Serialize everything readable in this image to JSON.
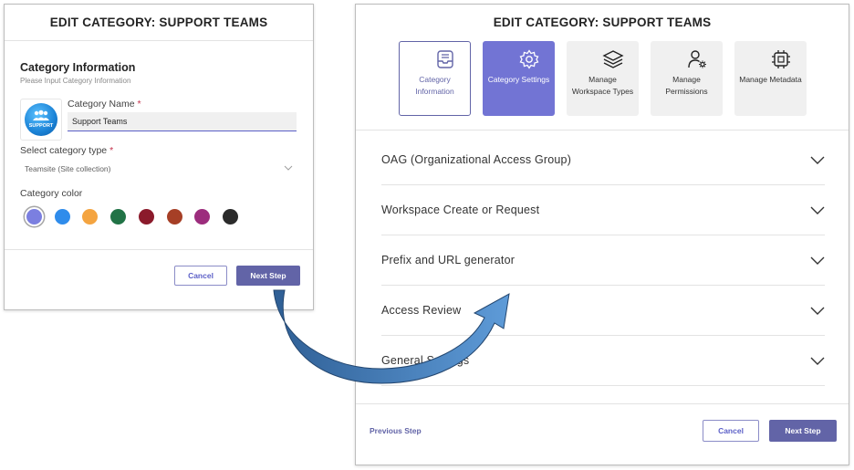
{
  "left_dialog": {
    "title": "EDIT CATEGORY: SUPPORT TEAMS",
    "section_title": "Category Information",
    "section_subtitle": "Please Input Category Information",
    "logo_text": "SUPPORT",
    "category_name_label": "Category Name",
    "required_mark": "*",
    "category_name_value": "Support Teams",
    "category_type_label": "Select category type",
    "category_type_value": "Teamsite (Site collection)",
    "category_color_label": "Category color",
    "colors": [
      "#7b7fe0",
      "#2f8ceb",
      "#f4a440",
      "#217346",
      "#8b1a2b",
      "#a63f26",
      "#9c2d7d",
      "#2b2b2b"
    ],
    "selected_color_index": 0,
    "cancel_label": "Cancel",
    "next_label": "Next Step"
  },
  "right_dialog": {
    "title": "EDIT CATEGORY: SUPPORT TEAMS",
    "steps": [
      {
        "label": "Category Information",
        "icon": "tray-icon",
        "state": "done"
      },
      {
        "label": "Category Settings",
        "icon": "gear-icon",
        "state": "active"
      },
      {
        "label": "Manage Workspace Types",
        "icon": "layers-icon",
        "state": "inactive"
      },
      {
        "label": "Manage Permissions",
        "icon": "user-gear-icon",
        "state": "inactive"
      },
      {
        "label": "Manage Metadata",
        "icon": "chip-icon",
        "state": "inactive"
      }
    ],
    "sections": [
      "OAG (Organizational Access Group)",
      "Workspace Create or Request",
      "Prefix and URL generator",
      "Access Review",
      "General Settings"
    ],
    "previous_label": "Previous Step",
    "cancel_label": "Cancel",
    "next_label": "Next Step"
  },
  "accent_color": "#6264a7"
}
